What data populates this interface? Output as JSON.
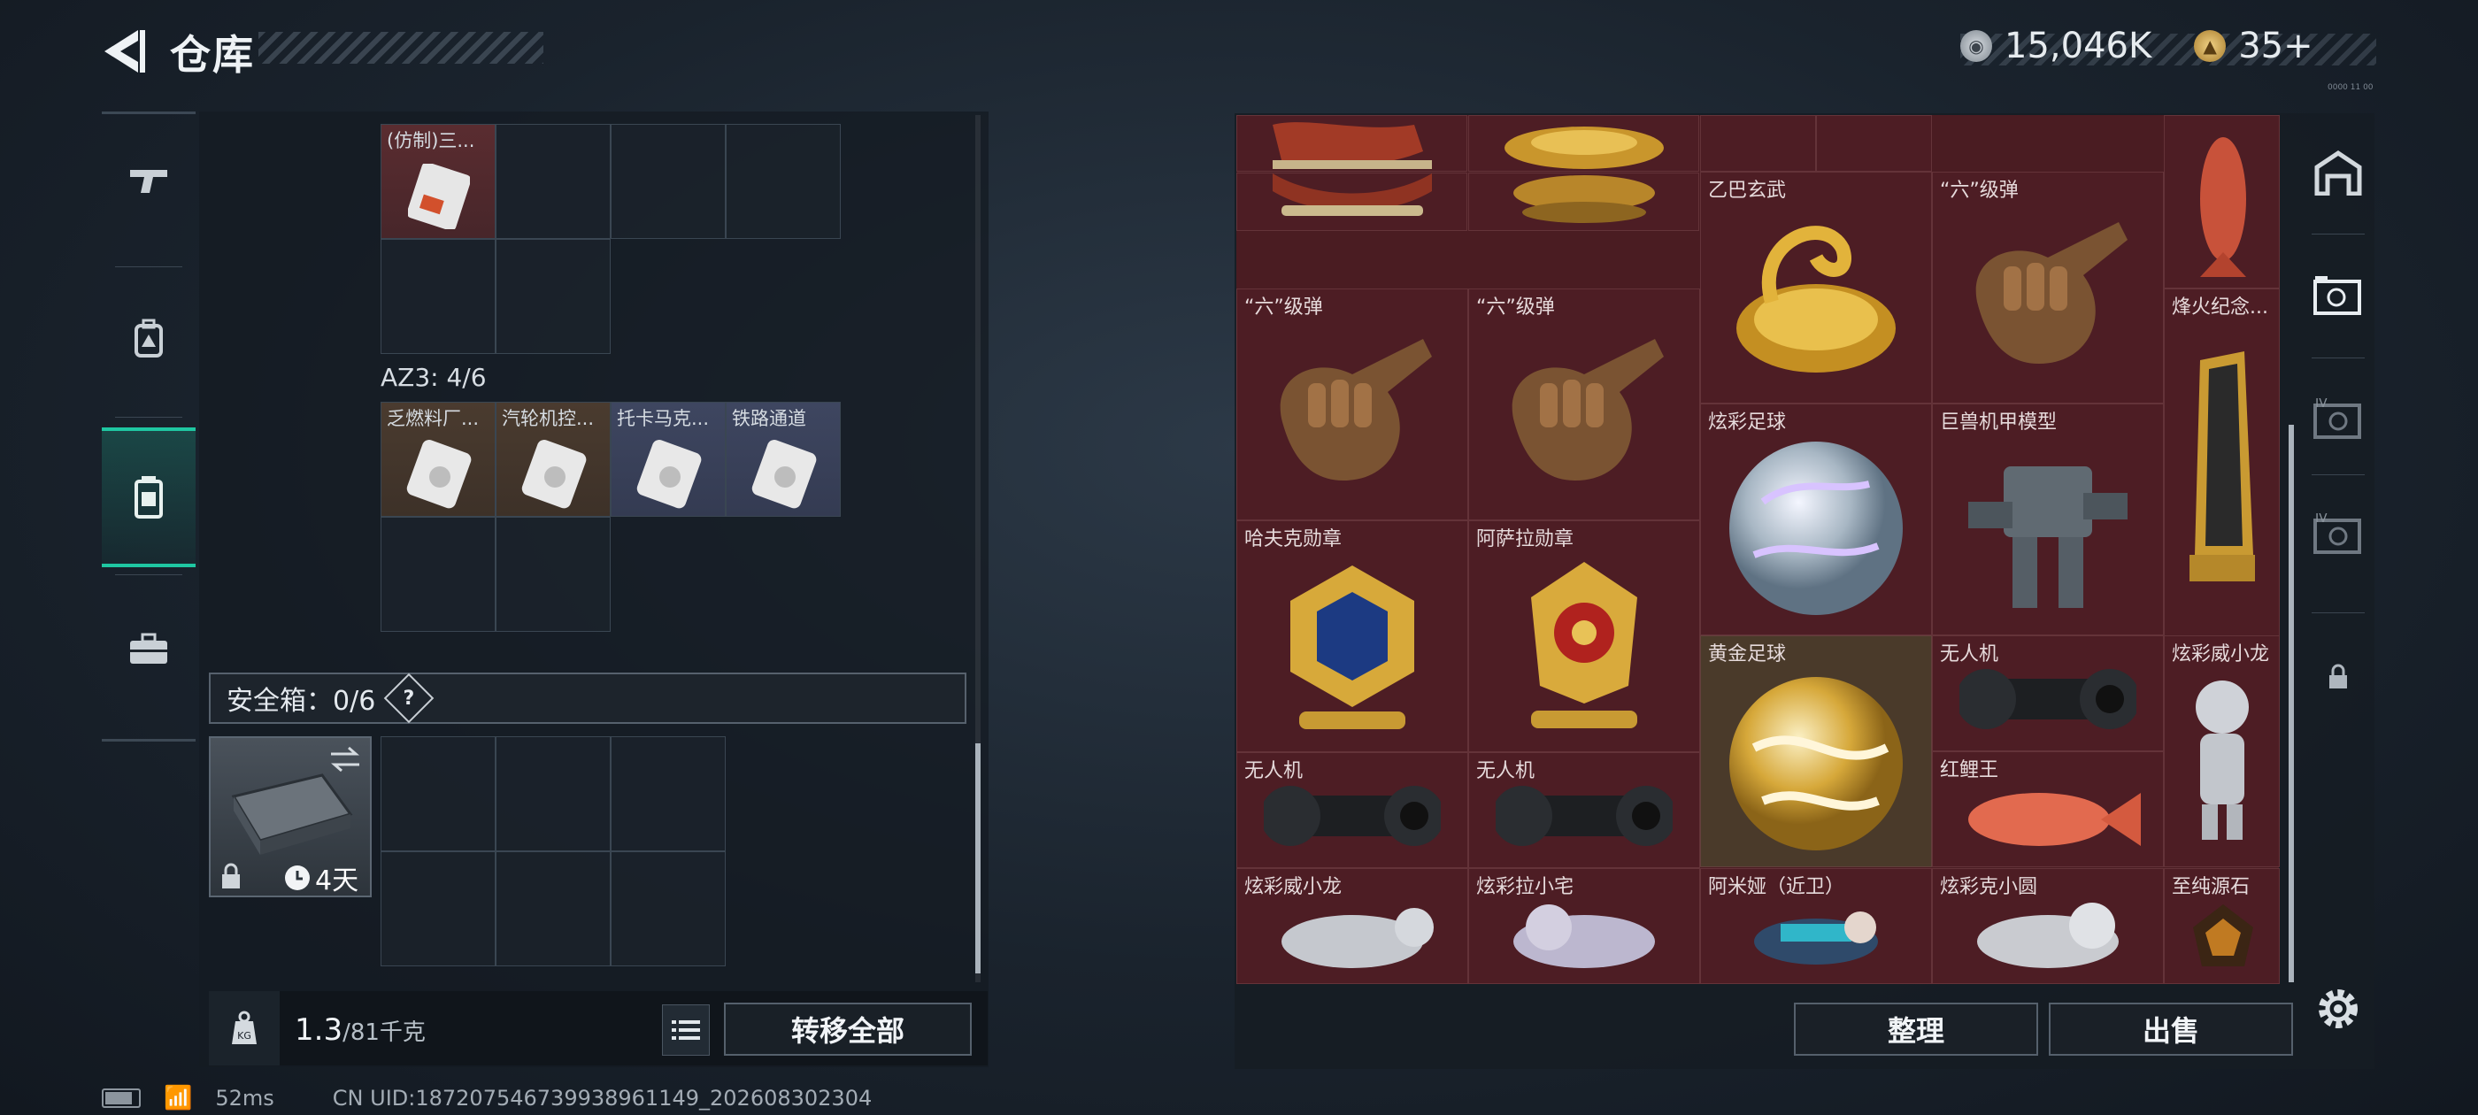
{
  "header": {
    "title": "仓库",
    "currency_silver": "15,046K",
    "currency_gold": "35+",
    "small_tag": "0000 11 00"
  },
  "rail": [
    "gun-icon",
    "backpack-icon",
    "vest-icon",
    "toolbox-icon"
  ],
  "backpack": {
    "top_item_label": "(仿制)三...",
    "az3_label": "AZ3: 4/6",
    "az3_items": [
      "乏燃料厂...",
      "汽轮机控...",
      "托卡马克...",
      "铁路通道"
    ],
    "safebox_label": "安全箱：0/6",
    "safebox_help": "?",
    "case_time": "4天",
    "weight_value": "1.3",
    "weight_total": "/81千克",
    "transfer_all": "转移全部"
  },
  "stash": {
    "labels": {
      "yiba": "乙巴玄武",
      "liu1": "“六”级弹",
      "liu2": "“六”级弹",
      "liu3": "“六”级弹",
      "fenghuo": "烽火纪念...",
      "xuancai_ball": "炫彩足球",
      "jushou": "巨兽机甲模型",
      "hafuke": "哈夫克勋章",
      "asala": "阿萨拉勋章",
      "gold_ball": "黄金足球",
      "drone1": "无人机",
      "drone2": "无人机",
      "drone3": "无人机",
      "xiaolong1": "炫彩威小龙",
      "koi": "红鲤王",
      "xiaolong2": "炫彩威小龙",
      "laxiaozhai": "炫彩拉小宅",
      "amiya": "阿米娅（近卫）",
      "keer": "炫彩克小圆",
      "zhichun": "至纯源石"
    },
    "sort_button": "整理",
    "sell_button": "出售"
  },
  "status": {
    "ping": "52ms",
    "uid": "CN UID:1872075467399389611​49_202608302304"
  },
  "colors": {
    "accent": "#1fc7a2",
    "stash_bg": "#4d1d24"
  }
}
